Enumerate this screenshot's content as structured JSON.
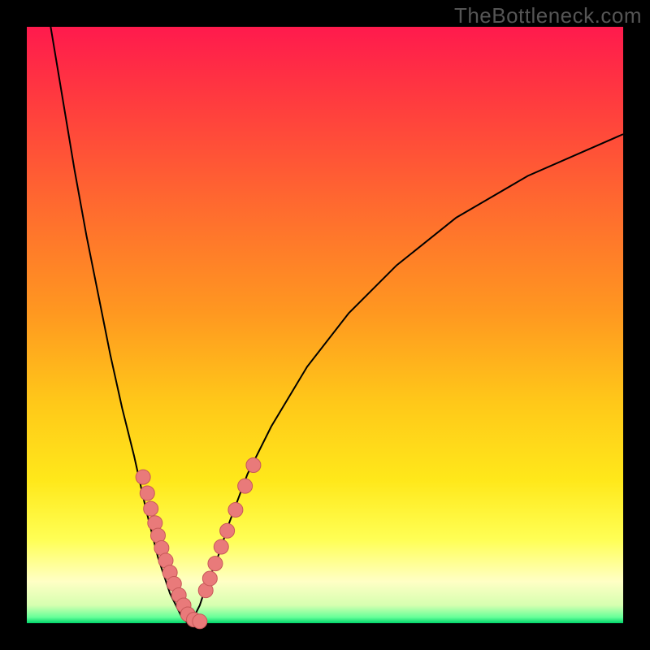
{
  "watermark": "TheBottleneck.com",
  "colors": {
    "frame": "#000000",
    "gradient_stops": [
      "#ff1a4d",
      "#ff3a3f",
      "#ff6a2f",
      "#ff9820",
      "#ffc819",
      "#ffe81a",
      "#ffff55",
      "#ffffc5",
      "#d6ffb0",
      "#66ff99",
      "#00d66a"
    ],
    "curve": "#000000",
    "dot_fill": "#e97a7a",
    "dot_stroke": "#c75858"
  },
  "chart_data": {
    "type": "line",
    "title": "",
    "xlabel": "",
    "ylabel": "",
    "xlim": [
      0,
      100
    ],
    "ylim": [
      0,
      100
    ],
    "note": "Bottleneck-style V curve. Y ≈ mismatch %, minimum near x≈27. Values are visual estimates from the raster; no axes/ticks/labels are rendered.",
    "series": [
      {
        "name": "left-branch",
        "x": [
          4,
          6,
          8,
          10,
          12,
          14,
          16,
          18,
          20,
          22,
          23,
          24,
          25,
          26,
          27
        ],
        "y": [
          100,
          88,
          76,
          65,
          55,
          45,
          36,
          28,
          19,
          11,
          8,
          5,
          3,
          1,
          0
        ]
      },
      {
        "name": "right-branch",
        "x": [
          27,
          28,
          29,
          30,
          32,
          34,
          37,
          41,
          47,
          54,
          62,
          72,
          84,
          100
        ],
        "y": [
          0,
          1,
          3,
          6,
          11,
          17,
          25,
          33,
          43,
          52,
          60,
          68,
          75,
          82
        ]
      }
    ],
    "dots_left": {
      "name": "left-dots",
      "x": [
        19.5,
        20.2,
        20.8,
        21.5,
        22.0,
        22.6,
        23.3,
        24.0,
        24.7,
        25.5,
        26.3,
        27.0,
        28.0,
        29.0
      ],
      "y": [
        24.5,
        21.8,
        19.2,
        16.8,
        14.7,
        12.6,
        10.5,
        8.5,
        6.6,
        4.7,
        3.0,
        1.5,
        0.6,
        0.3
      ]
    },
    "dots_right": {
      "name": "right-dots",
      "x": [
        30.0,
        30.7,
        31.6,
        32.6,
        33.6,
        35.0,
        36.6,
        38.0
      ],
      "y": [
        5.5,
        7.5,
        10.0,
        12.8,
        15.5,
        19.0,
        23.0,
        26.5
      ]
    }
  }
}
